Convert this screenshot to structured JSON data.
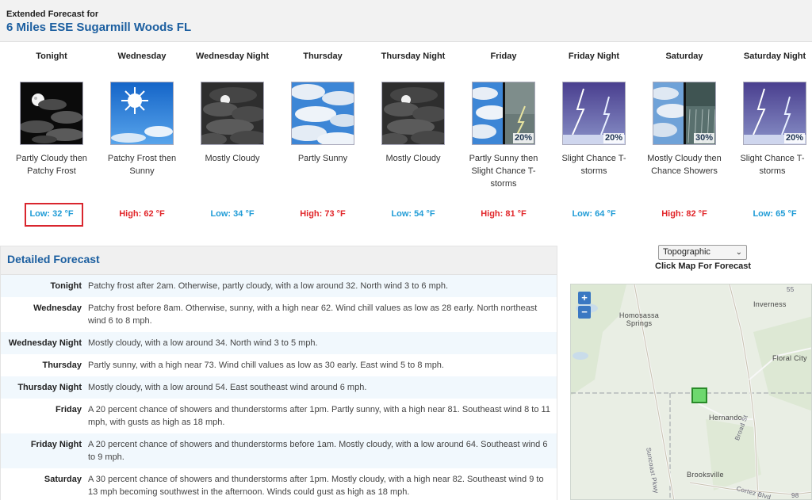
{
  "header": {
    "title_small": "Extended Forecast for",
    "location": "6 Miles ESE Sugarmill Woods FL"
  },
  "periods": [
    {
      "name": "Tonight",
      "icon": "night-partly-cloudy-icon",
      "desc": "Partly Cloudy then Patchy Frost",
      "temp": "Low: 32 °F",
      "temp_type": "low",
      "pop": ""
    },
    {
      "name": "Wednesday",
      "icon": "sunny-icon",
      "desc": "Patchy Frost then Sunny",
      "temp": "High: 62 °F",
      "temp_type": "high",
      "pop": ""
    },
    {
      "name": "Wednesday Night",
      "icon": "night-mostly-cloudy-icon",
      "desc": "Mostly Cloudy",
      "temp": "Low: 34 °F",
      "temp_type": "low",
      "pop": ""
    },
    {
      "name": "Thursday",
      "icon": "partly-sunny-icon",
      "desc": "Partly Sunny",
      "temp": "High: 73 °F",
      "temp_type": "high",
      "pop": ""
    },
    {
      "name": "Thursday Night",
      "icon": "night-mostly-cloudy-icon",
      "desc": "Mostly Cloudy",
      "temp": "Low: 54 °F",
      "temp_type": "low",
      "pop": ""
    },
    {
      "name": "Friday",
      "icon": "partly-sunny-then-tstorm-icon",
      "desc": "Partly Sunny then Slight Chance T-storms",
      "temp": "High: 81 °F",
      "temp_type": "high",
      "pop": "20%"
    },
    {
      "name": "Friday Night",
      "icon": "tstorm-icon",
      "desc": "Slight Chance T-storms",
      "temp": "Low: 64 °F",
      "temp_type": "low",
      "pop": "20%"
    },
    {
      "name": "Saturday",
      "icon": "mostly-cloudy-then-showers-icon",
      "desc": "Mostly Cloudy then Chance Showers",
      "temp": "High: 82 °F",
      "temp_type": "high",
      "pop": "30%"
    },
    {
      "name": "Saturday Night",
      "icon": "tstorm-icon",
      "desc": "Slight Chance T-storms",
      "temp": "Low: 65 °F",
      "temp_type": "low",
      "pop": "20%"
    }
  ],
  "detailed": {
    "title": "Detailed Forecast",
    "rows": [
      {
        "label": "Tonight",
        "text": "Patchy frost after 2am. Otherwise, partly cloudy, with a low around 32. North wind 3 to 6 mph."
      },
      {
        "label": "Wednesday",
        "text": "Patchy frost before 8am. Otherwise, sunny, with a high near 62. Wind chill values as low as 28 early. North northeast wind 6 to 8 mph."
      },
      {
        "label": "Wednesday Night",
        "text": "Mostly cloudy, with a low around 34. North wind 3 to 5 mph."
      },
      {
        "label": "Thursday",
        "text": "Partly sunny, with a high near 73. Wind chill values as low as 30 early. East wind 5 to 8 mph."
      },
      {
        "label": "Thursday Night",
        "text": "Mostly cloudy, with a low around 54. East southeast wind around 6 mph."
      },
      {
        "label": "Friday",
        "text": "A 20 percent chance of showers and thunderstorms after 1pm. Partly sunny, with a high near 81. Southeast wind 8 to 11 mph, with gusts as high as 18 mph."
      },
      {
        "label": "Friday Night",
        "text": "A 20 percent chance of showers and thunderstorms before 1am. Mostly cloudy, with a low around 64. Southeast wind 6 to 9 mph."
      },
      {
        "label": "Saturday",
        "text": "A 30 percent chance of showers and thunderstorms after 1pm. Mostly cloudy, with a high near 82. Southeast wind 9 to 13 mph becoming southwest in the afternoon. Winds could gust as high as 18 mph."
      }
    ]
  },
  "map": {
    "select_value": "Topographic",
    "caption": "Click Map For Forecast",
    "zoom_in": "+",
    "zoom_out": "−",
    "labels": {
      "homosassa": "Homosassa Springs",
      "inverness": "Inverness",
      "floral_city": "Floral City",
      "hernando": "Hernando",
      "brooksville": "Brooksville",
      "suncoast": "Suncoast Pkwy",
      "broad_st": "Broad St",
      "cortez": "Cortez Blvd",
      "route_98": "98",
      "route_55": "55"
    }
  },
  "colors": {
    "low": "#1e9bd6",
    "high": "#e1262a",
    "title_blue": "#1c5fa0",
    "highlight_border": "#d9262e"
  }
}
